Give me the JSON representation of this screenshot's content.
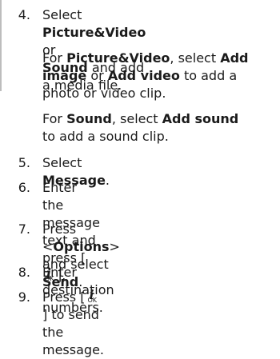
{
  "steps": [
    {
      "num": "4.",
      "l1a": "Select ",
      "l1b": "Picture&Video",
      "l1c": " or",
      "l2a": "Sound",
      "l2b": " and add a media file."
    },
    {
      "num": "5.",
      "a": "Select ",
      "b": "Message",
      "c": "."
    },
    {
      "num": "6.",
      "l1": "Enter the message text and",
      "l2a": "press [",
      "l2b": "]."
    },
    {
      "num": "7.",
      "a": "Press <",
      "b": "Options",
      "c": "> and select",
      "l2a": "Send",
      "l2b": "."
    },
    {
      "num": "8.",
      "a": "Enter destination numbers."
    },
    {
      "num": "9.",
      "a": "Press [",
      "b": "] to send the message."
    }
  ],
  "notes": {
    "picture": {
      "a": "For ",
      "b": "Picture&Video",
      "c": ", select ",
      "d": "Add",
      "e": "image",
      "f": " or ",
      "g": "Add video",
      "h": " to add a",
      "i": "photo or video clip."
    },
    "sound": {
      "a": "For ",
      "b": "Sound",
      "c": ", select ",
      "d": "Add sound",
      "e": "to add a sound clip."
    }
  },
  "icons": {
    "ok_key": "ok-key-icon",
    "i_glyph": "i",
    "ok_text": "OK"
  }
}
